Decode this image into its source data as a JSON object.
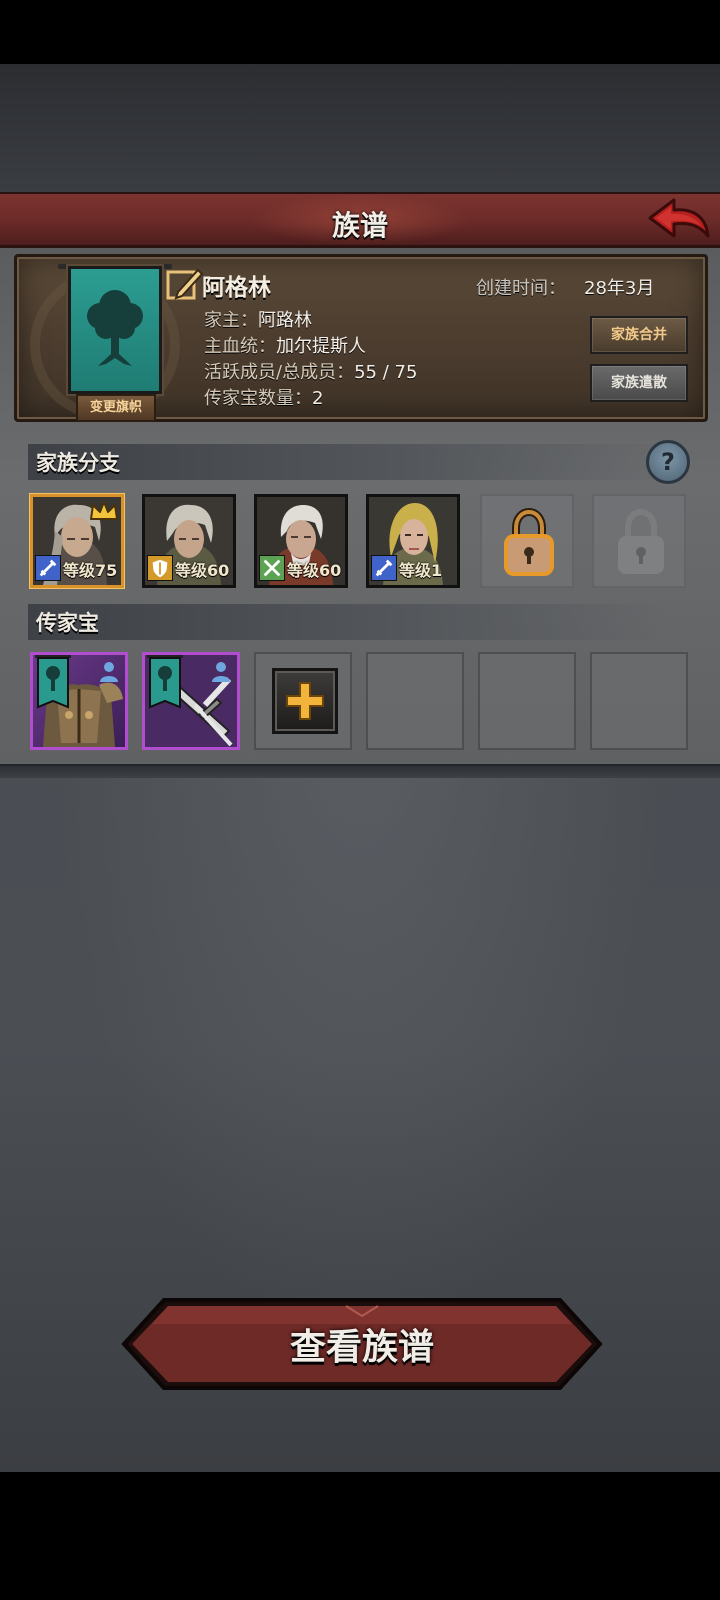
{
  "header": {
    "title": "族谱",
    "back_icon": "red-back-arrow-icon"
  },
  "family": {
    "name": "阿格林",
    "change_banner_label": "变更旗帜",
    "created_label": "创建时间：",
    "created_value": "28年3月",
    "head_label": "家主：",
    "head_value": "阿路林",
    "bloodline_label": "主血统：",
    "bloodline_value": "加尔提斯人",
    "members_label": "活跃成员/总成员：",
    "members_value": "55 / 75",
    "heirloom_count_label": "传家宝数量：",
    "heirloom_count_value": "2",
    "merge_button": "家族合并",
    "disband_button": "家族遣散",
    "banner_color": "#2a9a8f"
  },
  "branches": {
    "title": "家族分支",
    "members": [
      {
        "level_label": "等级75",
        "class_icon": "sword-icon",
        "leader": true
      },
      {
        "level_label": "等级60",
        "class_icon": "shield-icon",
        "leader": false
      },
      {
        "level_label": "等级60",
        "class_icon": "crossed-swords-icon",
        "leader": false
      },
      {
        "level_label": "等级1",
        "class_icon": "sword-icon",
        "leader": false
      }
    ],
    "locked_slots": 2
  },
  "heirlooms": {
    "title": "传家宝",
    "items": [
      {
        "name": "armor-heirloom",
        "icon": "armor-icon"
      },
      {
        "name": "weapon-heirloom",
        "icon": "sword-icon"
      }
    ],
    "empty_slots": 3
  },
  "footer": {
    "view_button": "查看族谱"
  },
  "colors": {
    "accent_red": "#7a302c",
    "gold": "#d9922a",
    "heirloom_purple": "#b14ed0"
  }
}
